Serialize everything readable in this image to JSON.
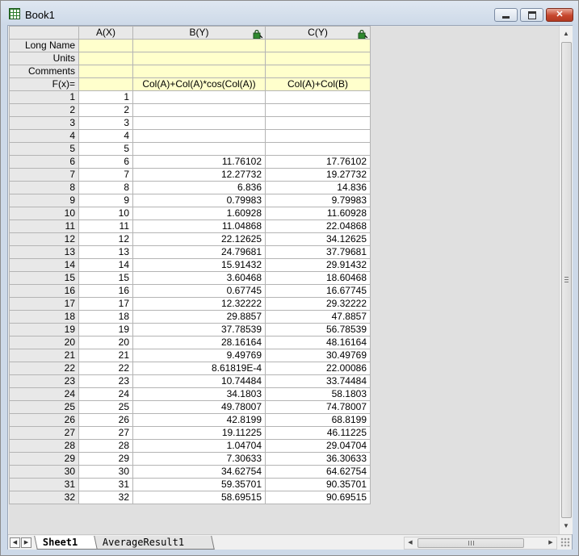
{
  "window": {
    "title": "Book1"
  },
  "columns": [
    {
      "label": "A(X)",
      "locked": false
    },
    {
      "label": "B(Y)",
      "locked": true
    },
    {
      "label": "C(Y)",
      "locked": true
    }
  ],
  "meta_rows": [
    {
      "label": "Long Name",
      "values": [
        "",
        "",
        ""
      ]
    },
    {
      "label": "Units",
      "values": [
        "",
        "",
        ""
      ]
    },
    {
      "label": "Comments",
      "values": [
        "",
        "",
        ""
      ]
    }
  ],
  "formula_row": {
    "label": "F(x)=",
    "values": [
      "",
      "Col(A)+Col(A)*cos(Col(A))",
      "Col(A)+Col(B)"
    ]
  },
  "rows": [
    {
      "n": "1",
      "a": "1",
      "b": "",
      "c": ""
    },
    {
      "n": "2",
      "a": "2",
      "b": "",
      "c": ""
    },
    {
      "n": "3",
      "a": "3",
      "b": "",
      "c": ""
    },
    {
      "n": "4",
      "a": "4",
      "b": "",
      "c": ""
    },
    {
      "n": "5",
      "a": "5",
      "b": "",
      "c": ""
    },
    {
      "n": "6",
      "a": "6",
      "b": "11.76102",
      "c": "17.76102"
    },
    {
      "n": "7",
      "a": "7",
      "b": "12.27732",
      "c": "19.27732"
    },
    {
      "n": "8",
      "a": "8",
      "b": "6.836",
      "c": "14.836"
    },
    {
      "n": "9",
      "a": "9",
      "b": "0.79983",
      "c": "9.79983"
    },
    {
      "n": "10",
      "a": "10",
      "b": "1.60928",
      "c": "11.60928"
    },
    {
      "n": "11",
      "a": "11",
      "b": "11.04868",
      "c": "22.04868"
    },
    {
      "n": "12",
      "a": "12",
      "b": "22.12625",
      "c": "34.12625"
    },
    {
      "n": "13",
      "a": "13",
      "b": "24.79681",
      "c": "37.79681"
    },
    {
      "n": "14",
      "a": "14",
      "b": "15.91432",
      "c": "29.91432"
    },
    {
      "n": "15",
      "a": "15",
      "b": "3.60468",
      "c": "18.60468"
    },
    {
      "n": "16",
      "a": "16",
      "b": "0.67745",
      "c": "16.67745"
    },
    {
      "n": "17",
      "a": "17",
      "b": "12.32222",
      "c": "29.32222"
    },
    {
      "n": "18",
      "a": "18",
      "b": "29.8857",
      "c": "47.8857"
    },
    {
      "n": "19",
      "a": "19",
      "b": "37.78539",
      "c": "56.78539"
    },
    {
      "n": "20",
      "a": "20",
      "b": "28.16164",
      "c": "48.16164"
    },
    {
      "n": "21",
      "a": "21",
      "b": "9.49769",
      "c": "30.49769"
    },
    {
      "n": "22",
      "a": "22",
      "b": "8.61819E-4",
      "c": "22.00086"
    },
    {
      "n": "23",
      "a": "23",
      "b": "10.74484",
      "c": "33.74484"
    },
    {
      "n": "24",
      "a": "24",
      "b": "34.1803",
      "c": "58.1803"
    },
    {
      "n": "25",
      "a": "25",
      "b": "49.78007",
      "c": "74.78007"
    },
    {
      "n": "26",
      "a": "26",
      "b": "42.8199",
      "c": "68.8199"
    },
    {
      "n": "27",
      "a": "27",
      "b": "19.11225",
      "c": "46.11225"
    },
    {
      "n": "28",
      "a": "28",
      "b": "1.04704",
      "c": "29.04704"
    },
    {
      "n": "29",
      "a": "29",
      "b": "7.30633",
      "c": "36.30633"
    },
    {
      "n": "30",
      "a": "30",
      "b": "34.62754",
      "c": "64.62754"
    },
    {
      "n": "31",
      "a": "31",
      "b": "59.35701",
      "c": "90.35701"
    },
    {
      "n": "32",
      "a": "32",
      "b": "58.69515",
      "c": "90.69515"
    }
  ],
  "sheet_tabs": [
    {
      "label": "Sheet1",
      "active": true
    },
    {
      "label": "AverageResult1",
      "active": false
    }
  ],
  "colors": {
    "meta_row_bg": "#ffffcc",
    "header_bg": "#e8e8e8",
    "lock_icon": "#2f8a2f"
  },
  "icons": {
    "app": "worksheet-grid-icon",
    "column_lock": "lock-icon"
  }
}
